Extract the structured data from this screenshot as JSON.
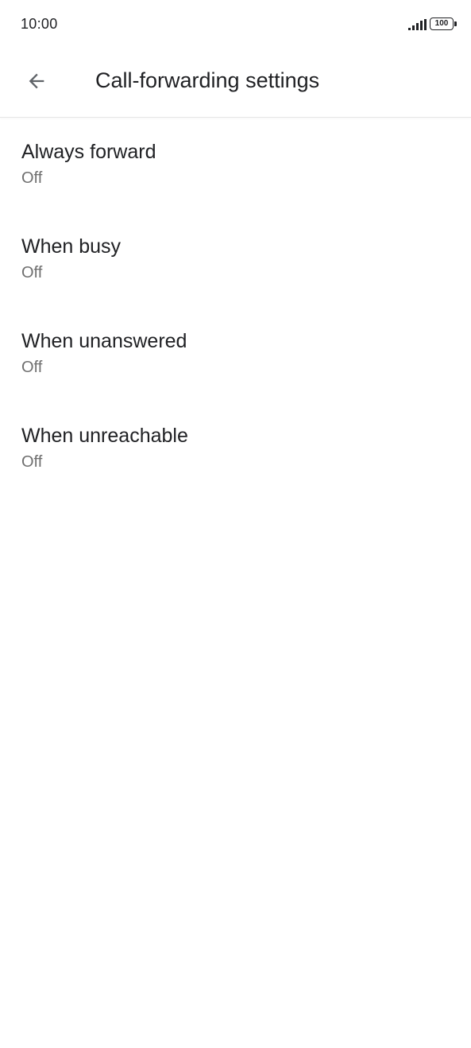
{
  "status_bar": {
    "time": "10:00",
    "battery": "100",
    "icons": [
      "signal-icon",
      "battery-icon"
    ]
  },
  "header": {
    "back_icon": "back-arrow-icon",
    "title": "Call-forwarding settings"
  },
  "options": [
    {
      "title": "Always forward",
      "summary": "Off"
    },
    {
      "title": "When busy",
      "summary": "Off"
    },
    {
      "title": "When unanswered",
      "summary": "Off"
    },
    {
      "title": "When unreachable",
      "summary": "Off"
    }
  ],
  "colors": {
    "text_primary": "#202124",
    "text_secondary": "#6f6f6f",
    "background": "#ffffff",
    "divider": "#e6e6e6"
  }
}
